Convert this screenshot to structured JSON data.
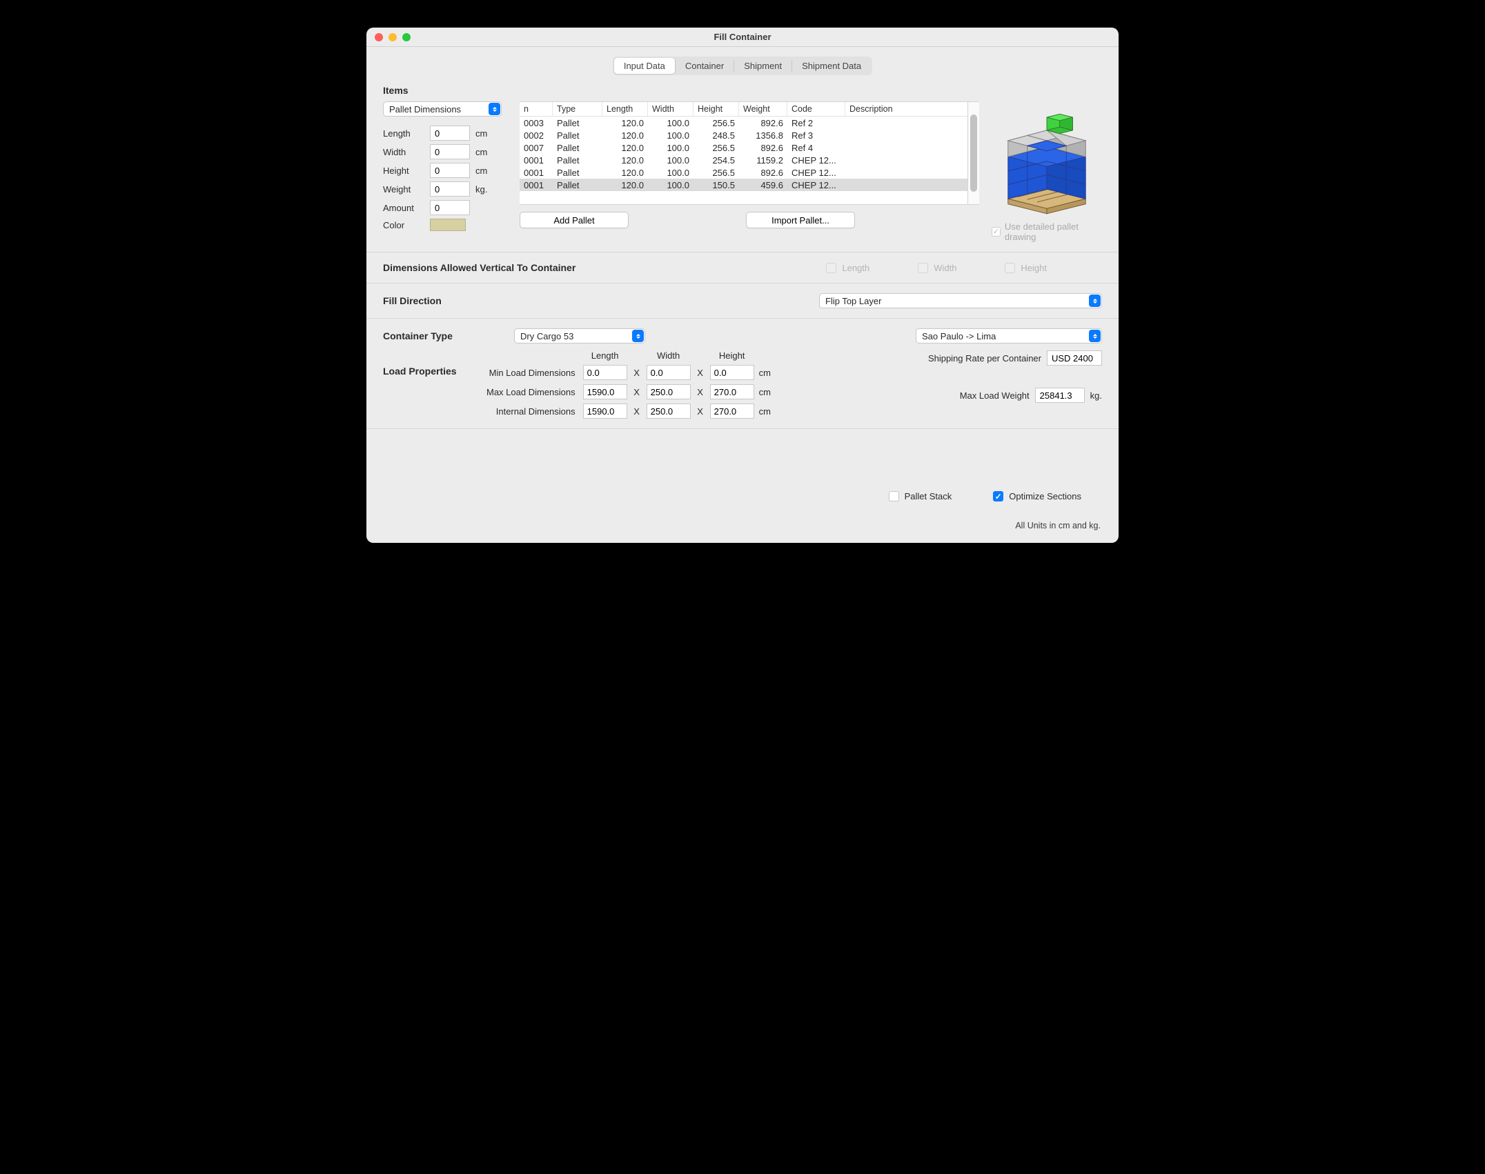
{
  "window": {
    "title": "Fill Container"
  },
  "tabs": {
    "items": [
      "Input Data",
      "Container",
      "Shipment",
      "Shipment Data"
    ],
    "active": 0
  },
  "items_section": {
    "title": "Items",
    "selector_label": "Pallet Dimensions",
    "fields": {
      "length": {
        "label": "Length",
        "value": "0",
        "unit": "cm"
      },
      "width": {
        "label": "Width",
        "value": "0",
        "unit": "cm"
      },
      "height": {
        "label": "Height",
        "value": "0",
        "unit": "cm"
      },
      "weight": {
        "label": "Weight",
        "value": "0",
        "unit": "kg."
      },
      "amount": {
        "label": "Amount",
        "value": "0",
        "unit": ""
      },
      "color_label": "Color",
      "color_value": "#d6d0a3"
    },
    "buttons": {
      "add": "Add Pallet",
      "import": "Import Pallet..."
    },
    "detailed_drawing_label": "Use detailed pallet drawing",
    "detailed_drawing_checked": true
  },
  "table": {
    "headers": {
      "n": "n",
      "type": "Type",
      "length": "Length",
      "width": "Width",
      "height": "Height",
      "weight": "Weight",
      "code": "Code",
      "description": "Description"
    },
    "rows": [
      {
        "n": "0003",
        "type": "Pallet",
        "length": "120.0",
        "width": "100.0",
        "height": "256.5",
        "weight": "892.6",
        "code": "Ref 2",
        "desc": ""
      },
      {
        "n": "0002",
        "type": "Pallet",
        "length": "120.0",
        "width": "100.0",
        "height": "248.5",
        "weight": "1356.8",
        "code": "Ref 3",
        "desc": ""
      },
      {
        "n": "0007",
        "type": "Pallet",
        "length": "120.0",
        "width": "100.0",
        "height": "256.5",
        "weight": "892.6",
        "code": "Ref 4",
        "desc": ""
      },
      {
        "n": "0001",
        "type": "Pallet",
        "length": "120.0",
        "width": "100.0",
        "height": "254.5",
        "weight": "1159.2",
        "code": "CHEP 12...",
        "desc": ""
      },
      {
        "n": "0001",
        "type": "Pallet",
        "length": "120.0",
        "width": "100.0",
        "height": "256.5",
        "weight": "892.6",
        "code": "CHEP 12...",
        "desc": ""
      },
      {
        "n": "0001",
        "type": "Pallet",
        "length": "120.0",
        "width": "100.0",
        "height": "150.5",
        "weight": "459.6",
        "code": "CHEP 12...",
        "desc": "",
        "selected": true
      }
    ]
  },
  "dims_vertical": {
    "title": "Dimensions Allowed Vertical To Container",
    "length": "Length",
    "width": "Width",
    "height": "Height"
  },
  "fill_direction": {
    "title": "Fill Direction",
    "value": "Flip Top Layer"
  },
  "container_type": {
    "title": "Container Type",
    "value": "Dry Cargo 53",
    "route": "Sao Paulo -> Lima"
  },
  "load_properties": {
    "title": "Load Properties",
    "col_labels": {
      "length": "Length",
      "width": "Width",
      "height": "Height"
    },
    "rows": {
      "min": {
        "label": "Min Load Dimensions",
        "l": "0.0",
        "w": "0.0",
        "h": "0.0",
        "unit": "cm"
      },
      "max": {
        "label": "Max Load Dimensions",
        "l": "1590.0",
        "w": "250.0",
        "h": "270.0",
        "unit": "cm"
      },
      "internal": {
        "label": "Internal Dimensions",
        "l": "1590.0",
        "w": "250.0",
        "h": "270.0",
        "unit": "cm"
      }
    },
    "shipping_rate": {
      "label": "Shipping Rate per Container",
      "value": "USD 2400"
    },
    "max_weight": {
      "label": "Max Load Weight",
      "value": "25841.3",
      "unit": "kg."
    }
  },
  "footer": {
    "pallet_stack": {
      "label": "Pallet Stack",
      "checked": false
    },
    "optimize": {
      "label": "Optimize Sections",
      "checked": true
    },
    "units_note": "All Units in cm and kg."
  }
}
